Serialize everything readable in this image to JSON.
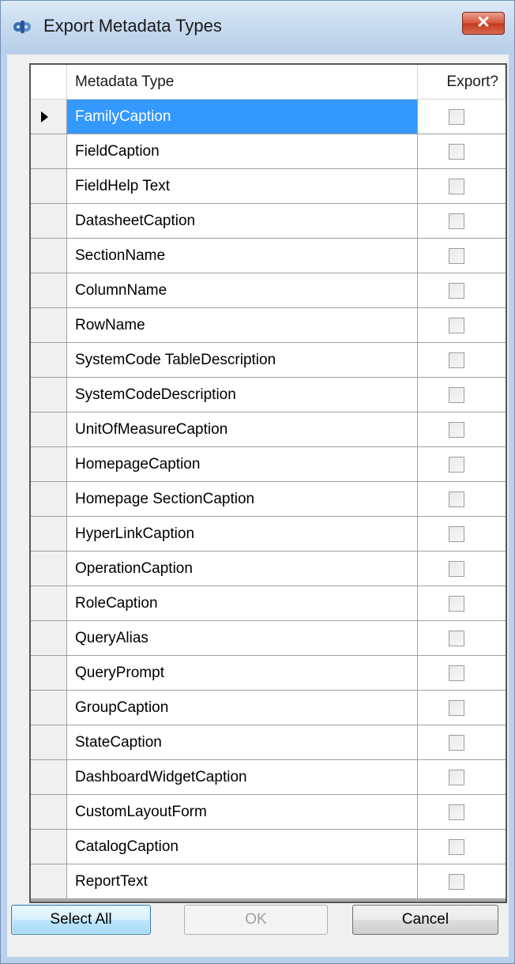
{
  "window": {
    "title": "Export Metadata Types",
    "close_label": "✕",
    "colors": {
      "selection": "#3399ff",
      "frame": "#b9d1ea"
    }
  },
  "grid": {
    "columns": {
      "type": "Metadata Type",
      "export": "Export?"
    },
    "current_row_index": 0,
    "rows": [
      {
        "type": "FamilyCaption",
        "export": false
      },
      {
        "type": "FieldCaption",
        "export": false
      },
      {
        "type": "FieldHelp Text",
        "export": false
      },
      {
        "type": "DatasheetCaption",
        "export": false
      },
      {
        "type": "SectionName",
        "export": false
      },
      {
        "type": "ColumnName",
        "export": false
      },
      {
        "type": "RowName",
        "export": false
      },
      {
        "type": "SystemCode TableDescription",
        "export": false
      },
      {
        "type": "SystemCodeDescription",
        "export": false
      },
      {
        "type": "UnitOfMeasureCaption",
        "export": false
      },
      {
        "type": "HomepageCaption",
        "export": false
      },
      {
        "type": "Homepage SectionCaption",
        "export": false
      },
      {
        "type": "HyperLinkCaption",
        "export": false
      },
      {
        "type": "OperationCaption",
        "export": false
      },
      {
        "type": "RoleCaption",
        "export": false
      },
      {
        "type": "QueryAlias",
        "export": false
      },
      {
        "type": "QueryPrompt",
        "export": false
      },
      {
        "type": "GroupCaption",
        "export": false
      },
      {
        "type": "StateCaption",
        "export": false
      },
      {
        "type": "DashboardWidgetCaption",
        "export": false
      },
      {
        "type": "CustomLayoutForm",
        "export": false
      },
      {
        "type": "CatalogCaption",
        "export": false
      },
      {
        "type": "ReportText",
        "export": false
      }
    ]
  },
  "buttons": {
    "select_all": "Select All",
    "ok": "OK",
    "cancel": "Cancel"
  }
}
